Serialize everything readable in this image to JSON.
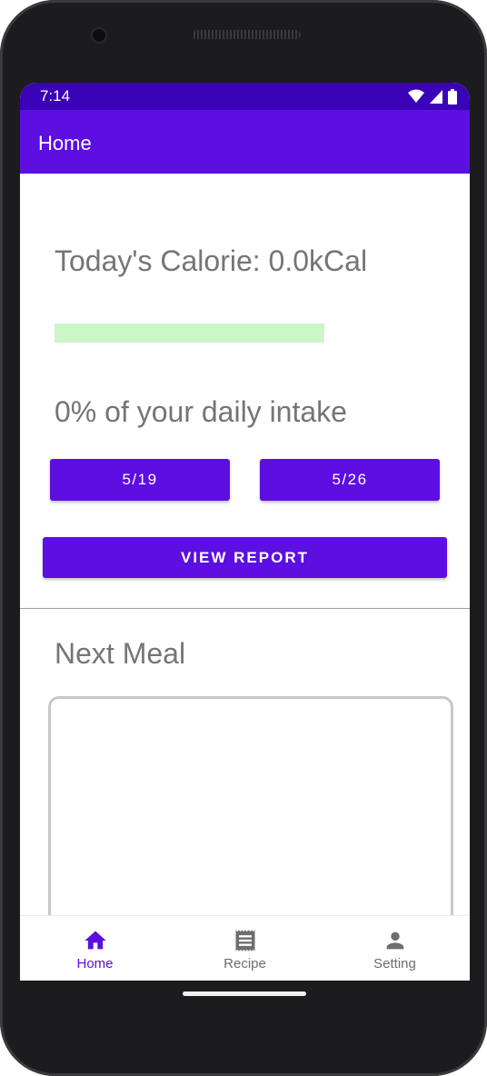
{
  "status_bar": {
    "time": "7:14"
  },
  "app_bar": {
    "title": "Home"
  },
  "calorie": {
    "title": "Today's Calorie: 0.0kCal",
    "progress_fraction": 0.0,
    "intake_text": "0% of your daily intake"
  },
  "week_buttons": [
    "5/19",
    "5/26"
  ],
  "report_button": "VIEW REPORT",
  "next_meal": {
    "title": "Next Meal"
  },
  "bottom_nav": {
    "items": [
      {
        "label": "Home",
        "icon": "home-icon",
        "active": true
      },
      {
        "label": "Recipe",
        "icon": "receipt-icon",
        "active": false
      },
      {
        "label": "Setting",
        "icon": "person-icon",
        "active": false
      }
    ]
  },
  "colors": {
    "primary": "#5c0fe0",
    "status_bar": "#3a03b8",
    "progress_track": "#ccf5c8",
    "text_gray": "#757575"
  }
}
